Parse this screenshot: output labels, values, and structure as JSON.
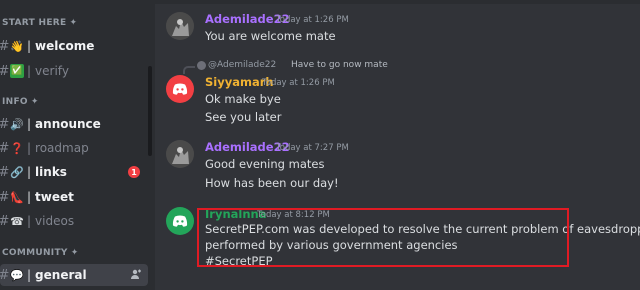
{
  "sidebar": {
    "categories": [
      {
        "label": "START HERE",
        "plus": "✦"
      },
      {
        "label": "INFO",
        "plus": "✦"
      },
      {
        "label": "COMMUNITY",
        "plus": "✦"
      }
    ],
    "channels": [
      {
        "emoji": "👋",
        "sep": "|",
        "name": "welcome"
      },
      {
        "emoji": "✅",
        "sep": "|",
        "name": "verify"
      },
      {
        "emoji": "🔊",
        "sep": "|",
        "name": "announce"
      },
      {
        "emoji": "❓",
        "sep": "|",
        "name": "roadmap"
      },
      {
        "emoji": "🔗",
        "sep": "|",
        "name": "links",
        "badge": "1"
      },
      {
        "emoji": "👠",
        "sep": "|",
        "name": "tweet"
      },
      {
        "emoji": "☎",
        "sep": "|",
        "name": "videos"
      },
      {
        "emoji": "💬",
        "sep": "|",
        "name": "general"
      }
    ],
    "hash": "#"
  },
  "messages": [
    {
      "author": "Ademilade22",
      "author_color": "#a970ff",
      "time": "Today at 1:26 PM",
      "lines": [
        "You are welcome mate"
      ]
    },
    {
      "reply": {
        "mention": "@Ademilade22",
        "text": "Have to go now mate"
      },
      "author": "Siyyamarh",
      "author_color": "#f0b232",
      "time": "Today at 1:26 PM",
      "lines": [
        "Ok make bye",
        "See you later"
      ]
    },
    {
      "author": "Ademilade22",
      "author_color": "#a970ff",
      "time": "Today at 7:27 PM",
      "lines": [
        "Good evening mates",
        "How has been our day!"
      ]
    },
    {
      "author": "Irynalnna",
      "author_color": "#23a55a",
      "time": "Today at 8:12 PM",
      "lines": [
        "SecretPEP.com was developed to resolve the current problem of eavesdropping",
        "performed by various government agencies",
        "#SecretPEP"
      ]
    }
  ],
  "colors": {
    "highlight": "#e01b24",
    "badge": "#f23f43"
  }
}
